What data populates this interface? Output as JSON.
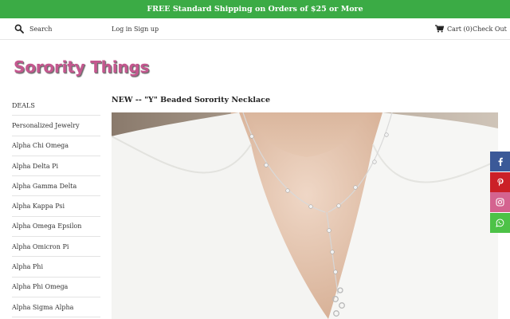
{
  "promo": {
    "text": "FREE Standard Shipping on Orders of $25 or More"
  },
  "header": {
    "search_placeholder": "Search",
    "login": "Log in",
    "signup": "Sign up",
    "cart": "Cart (0)",
    "checkout": "Check Out"
  },
  "logo": {
    "text": "Sorority Things"
  },
  "sidebar": {
    "items": [
      {
        "label": "DEALS"
      },
      {
        "label": "Personalized Jewelry"
      },
      {
        "label": "Alpha Chi Omega"
      },
      {
        "label": "Alpha Delta Pi"
      },
      {
        "label": "Alpha Gamma Delta"
      },
      {
        "label": "Alpha Kappa Psi"
      },
      {
        "label": "Alpha Omega Epsilon"
      },
      {
        "label": "Alpha Omicron Pi"
      },
      {
        "label": "Alpha Phi"
      },
      {
        "label": "Alpha Phi Omega"
      },
      {
        "label": "Alpha Sigma Alpha"
      }
    ]
  },
  "product": {
    "title": "NEW -- \"Y\" Beaded Sorority Necklace"
  },
  "colors": {
    "promo_bg": "#3bab45",
    "logo": "#c4588f",
    "facebook": "#3b5998",
    "pinterest": "#cb2027",
    "instagram": "#d4638f",
    "whatsapp": "#4dc247"
  },
  "social": {
    "icons": [
      "facebook-icon",
      "pinterest-icon",
      "instagram-icon",
      "whatsapp-icon"
    ]
  }
}
